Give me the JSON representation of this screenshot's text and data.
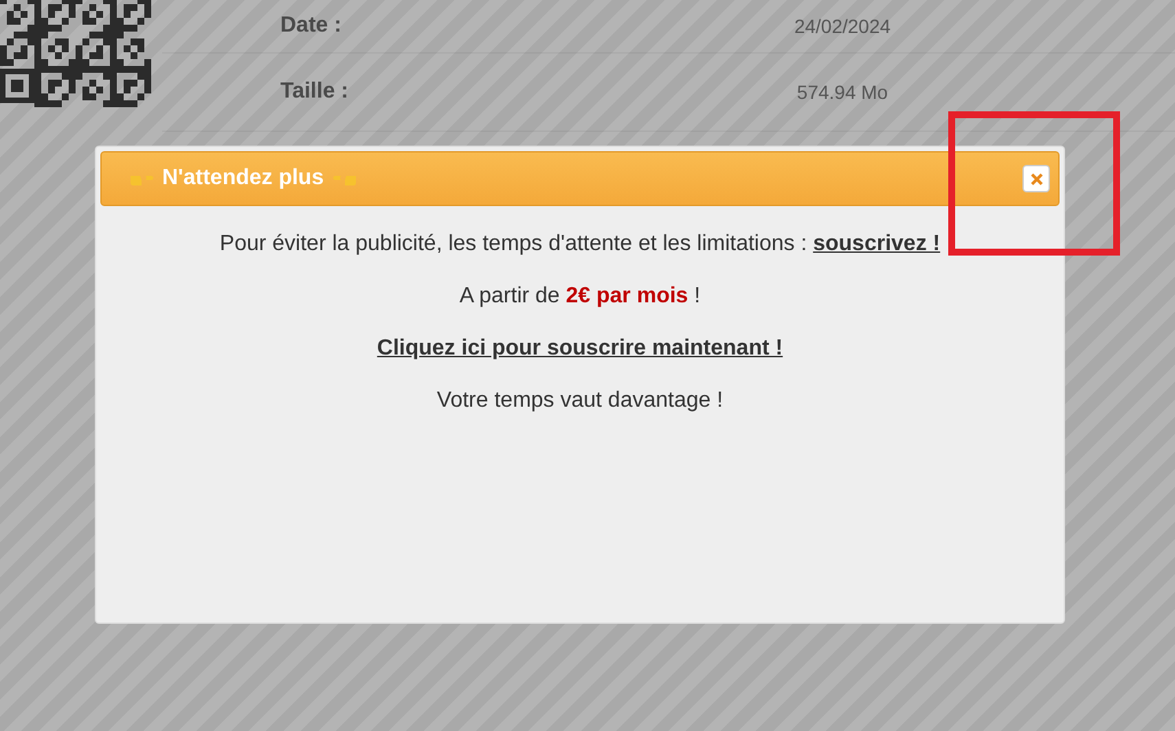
{
  "details": [
    {
      "label": "Date :",
      "value": "24/02/2024"
    },
    {
      "label": "Taille :",
      "value": "574.94 Mo"
    }
  ],
  "dialog": {
    "title": "N'attendez plus",
    "intro": "Pour éviter la publicité, les temps d'attente et les limitations :",
    "intro_link": "souscrivez !",
    "price": "A partir de **2€ par mois** !",
    "cta_link": "Cliquez ici pour souscrire maintenant !",
    "tagline": "Votre temps vaut davantage !"
  }
}
